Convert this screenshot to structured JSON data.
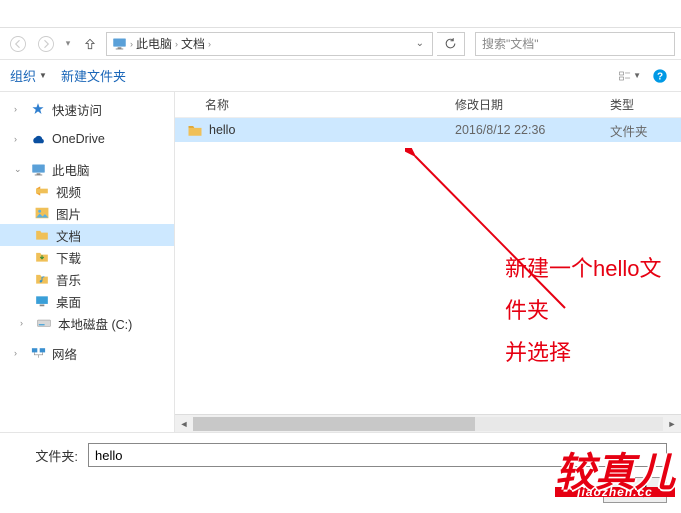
{
  "breadcrumb": {
    "root_icon": "pc",
    "seg1": "此电脑",
    "seg2": "文档"
  },
  "search": {
    "placeholder": "搜索\"文档\""
  },
  "toolbar": {
    "organize": "组织",
    "new_folder": "新建文件夹"
  },
  "columns": {
    "name": "名称",
    "modified": "修改日期",
    "type": "类型"
  },
  "sidebar": {
    "quick": "快速访问",
    "onedrive": "OneDrive",
    "thispc": "此电脑",
    "videos": "视频",
    "pictures": "图片",
    "documents": "文档",
    "downloads": "下载",
    "music": "音乐",
    "desktop": "桌面",
    "disk_c": "本地磁盘 (C:)",
    "network": "网络"
  },
  "files": [
    {
      "name": "hello",
      "modified": "2016/8/12 22:36",
      "type": "文件夹",
      "selected": true
    }
  ],
  "annotation": {
    "line1": "新建一个hello文件夹",
    "line2": "并选择"
  },
  "footer": {
    "label": "文件夹:",
    "value": "hello",
    "select_btn": "选择"
  },
  "watermark": {
    "main": "较真儿",
    "sub": "jiaozhen.cc"
  }
}
